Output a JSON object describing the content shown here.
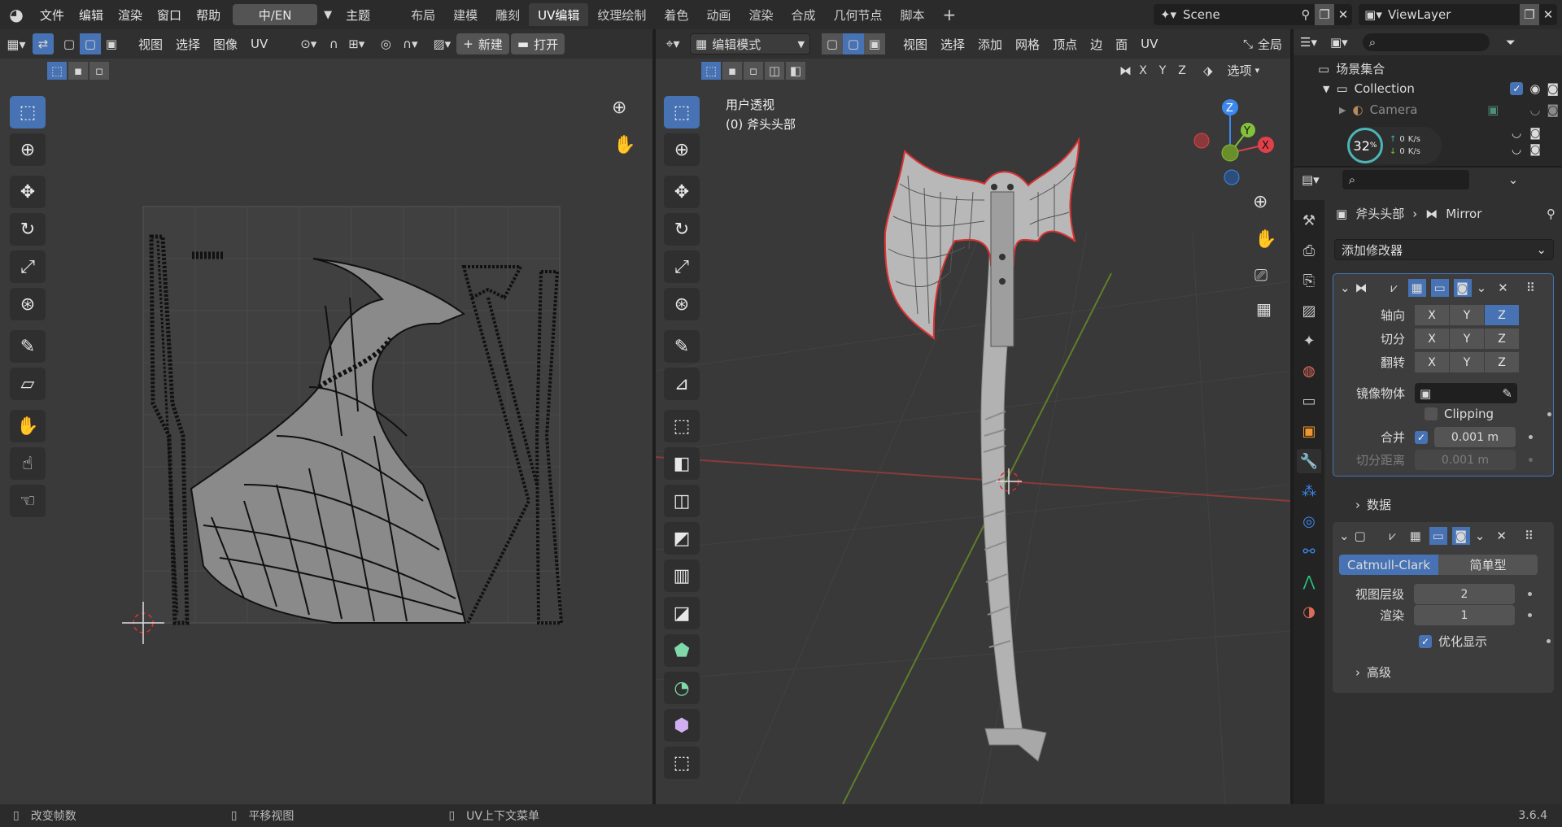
{
  "topbar": {
    "menus": [
      "文件",
      "编辑",
      "渲染",
      "窗口",
      "帮助"
    ],
    "lang_button": "中/EN",
    "theme": "主题",
    "workspaces": [
      "布局",
      "建模",
      "雕刻",
      "UV编辑",
      "纹理绘制",
      "着色",
      "动画",
      "渲染",
      "合成",
      "几何节点",
      "脚本"
    ],
    "active_workspace": "UV编辑",
    "add_workspace": "+",
    "scene": "Scene",
    "view_layer": "ViewLayer"
  },
  "uv_editor": {
    "menus": [
      "视图",
      "选择",
      "图像",
      "UV"
    ],
    "new_label": "新建",
    "open_label": "打开"
  },
  "viewport": {
    "mode": "编辑模式",
    "menus": [
      "视图",
      "选择",
      "添加",
      "网格",
      "顶点",
      "边",
      "面",
      "UV"
    ],
    "global_label": "全局",
    "axes": [
      "X",
      "Y",
      "Z"
    ],
    "options_label": "选项",
    "view_name": "用户透视",
    "object_name": "(0) 斧头头部"
  },
  "outliner": {
    "scene_collection": "场景集合",
    "collection": "Collection",
    "camera": "Camera",
    "net_percent": "32",
    "net_percent_unit": "%",
    "upload": "0",
    "download": "0",
    "rate_unit": "K/s"
  },
  "properties": {
    "object": "斧头头部",
    "modifier_name": "Mirror",
    "add_modifier": "添加修改器",
    "mirror": {
      "axis_label": "轴向",
      "bisect_label": "切分",
      "flip_label": "翻转",
      "axes": [
        "X",
        "Y",
        "Z"
      ],
      "mirror_object_label": "镜像物体",
      "clipping_label": "Clipping",
      "merge_label": "合并",
      "merge_value": "0.001 m",
      "bisect_distance_label": "切分距离",
      "bisect_distance_value": "0.001 m",
      "data_label": "数据"
    },
    "subsurf": {
      "catmull": "Catmull-Clark",
      "simple": "简单型",
      "viewport_levels_label": "视图层级",
      "viewport_levels": "2",
      "render_label": "渲染",
      "render_levels": "1",
      "optimal_label": "优化显示",
      "advanced_label": "高级"
    }
  },
  "status": {
    "left": "改变帧数",
    "middle": "平移视图",
    "right": "UV上下文菜单",
    "version": "3.6.4"
  },
  "colors": {
    "accent": "#4772b3",
    "axis_x": "#e0404a",
    "axis_y": "#84c13b",
    "axis_z": "#3d88ee"
  }
}
